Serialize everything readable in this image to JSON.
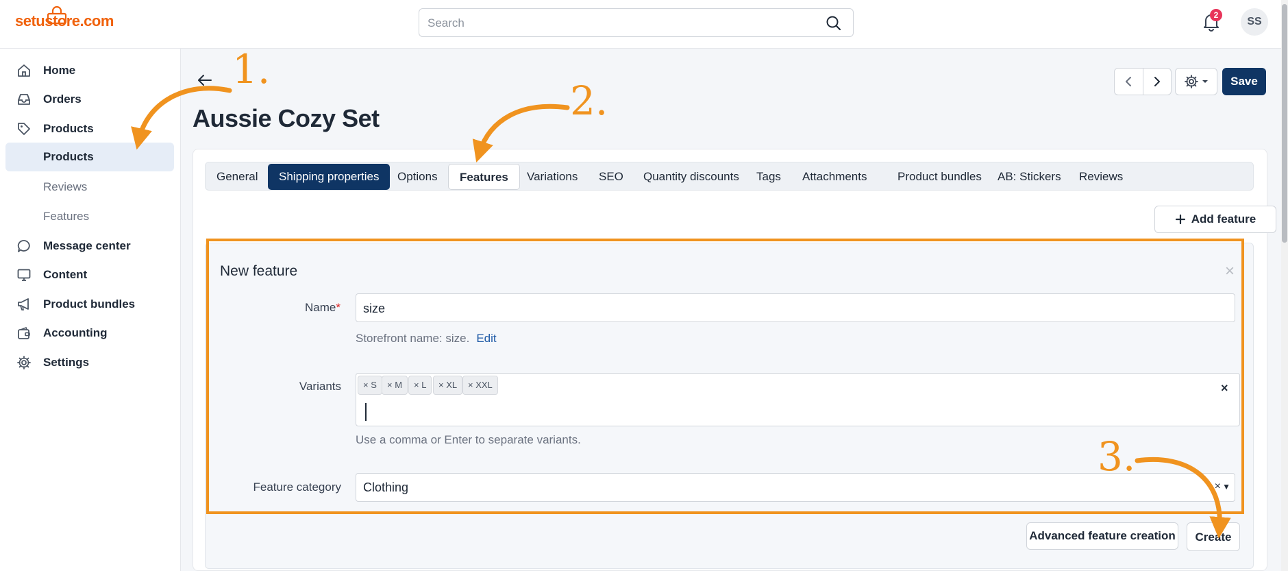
{
  "header": {
    "logo_text": "setustore.com",
    "search_placeholder": "Search",
    "notification_count": "2",
    "avatar_initials": "SS"
  },
  "sidebar": {
    "items": [
      {
        "label": "Home",
        "icon": "home-icon"
      },
      {
        "label": "Orders",
        "icon": "inbox-icon"
      },
      {
        "label": "Products",
        "icon": "tag-icon"
      },
      {
        "label": "Products",
        "icon": ""
      },
      {
        "label": "Reviews",
        "icon": ""
      },
      {
        "label": "Features",
        "icon": ""
      },
      {
        "label": "Message center",
        "icon": "chat-icon"
      },
      {
        "label": "Content",
        "icon": "monitor-icon"
      },
      {
        "label": "Product bundles",
        "icon": "megaphone-icon"
      },
      {
        "label": "Accounting",
        "icon": "wallet-icon"
      },
      {
        "label": "Settings",
        "icon": "gear-icon"
      }
    ]
  },
  "page": {
    "title": "Aussie Cozy Set",
    "save_label": "Save"
  },
  "tabs": [
    {
      "label": "General"
    },
    {
      "label": "Shipping properties"
    },
    {
      "label": "Options"
    },
    {
      "label": "Features"
    },
    {
      "label": "Variations"
    },
    {
      "label": "SEO"
    },
    {
      "label": "Quantity discounts"
    },
    {
      "label": "Tags"
    },
    {
      "label": "Attachments"
    },
    {
      "label": "Product bundles"
    },
    {
      "label": "AB: Stickers"
    },
    {
      "label": "Reviews"
    }
  ],
  "features": {
    "add_label": "Add feature",
    "panel_title": "New feature",
    "name_label": "Name",
    "name_required_mark": "*",
    "name_value": "size",
    "storefront_text": "Storefront name: size.",
    "edit_label": "Edit",
    "variants_label": "Variants",
    "variants": [
      "× S",
      "× M",
      "× L",
      "× XL",
      "× XXL"
    ],
    "variants_clear": "×",
    "variants_help": "Use a comma or Enter to separate variants.",
    "category_label": "Feature category",
    "category_value": "Clothing",
    "category_clear": "×",
    "category_dropdown": "▼",
    "advanced_label": "Advanced feature creation",
    "create_label": "Create"
  },
  "annotations": {
    "step1": "1.",
    "step2": "2.",
    "step3": "3.",
    "color": "#f0931f"
  }
}
